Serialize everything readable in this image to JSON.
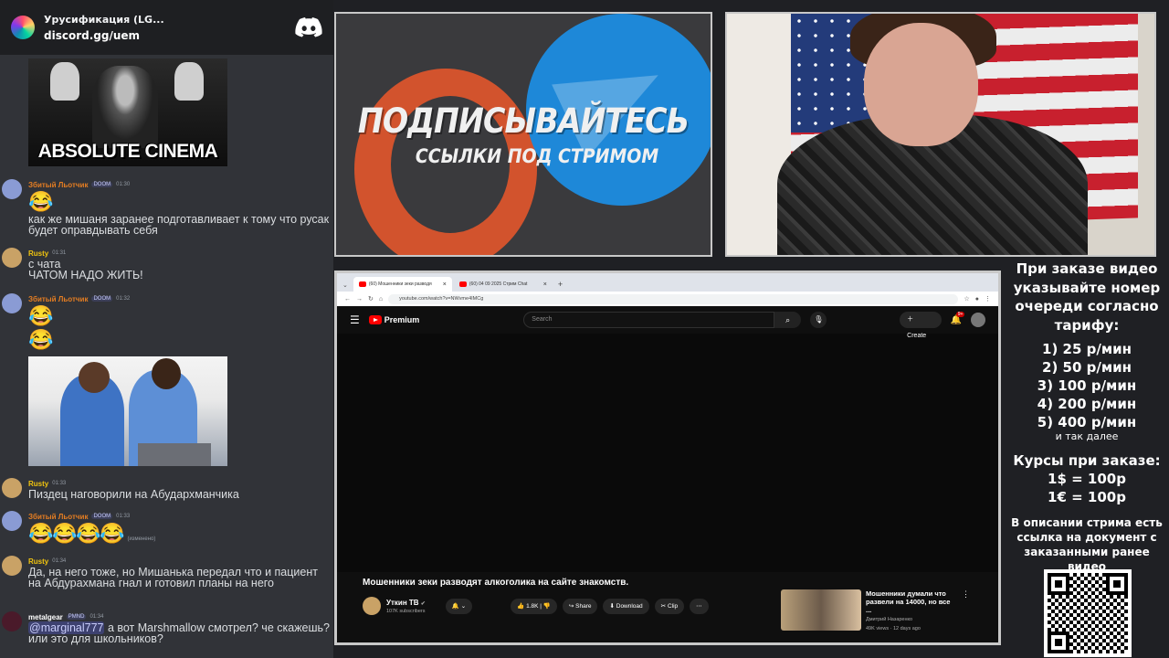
{
  "chat": {
    "server_name": "Урусификация (LG...",
    "server_link": "discord.gg/uem",
    "meme_caption": "ABSOLUTE CINEMA",
    "messages": [
      {
        "user": "Збитый Льотчик",
        "badge": "DOOM",
        "time": "01:30",
        "text": "как же мишаня заранее подготавливает к тому что русак будет оправдывать себя",
        "color": "#e67e22"
      },
      {
        "user": "Rusty",
        "badge": "",
        "time": "01:31",
        "line1": "с чата",
        "line2": "ЧАТОМ НАДО ЖИТЬ!",
        "color": "#f1c40f"
      },
      {
        "user": "Збитый Льотчик",
        "badge": "DOOM",
        "time": "01:32",
        "color": "#e67e22"
      },
      {
        "user": "Rusty",
        "badge": "",
        "time": "01:33",
        "text": "Пиздец наговорили на Абудархманчика",
        "color": "#f1c40f"
      },
      {
        "user": "Збитый Льотчик",
        "badge": "DOOM",
        "time": "01:33",
        "edited": "(изменено)",
        "color": "#e67e22"
      },
      {
        "user": "Rusty",
        "badge": "",
        "time": "01:34",
        "text": "Да, на него тоже, но Мишанька передал что и пациент на Абдурахмана гнал и готовил планы на него",
        "color": "#f1c40f"
      },
      {
        "user": "metalgear",
        "badge": "PMND",
        "time": "01:34",
        "mention": "@marginal777",
        "text": " а вот Marshmallow смотрел? че скажешь? или это для школьников?",
        "color": "#ffffff"
      }
    ]
  },
  "promo": {
    "title": "ПОДПИСЫВАЙТЕСЬ",
    "subtitle": "ССЫЛКИ ПОД СТРИМОМ"
  },
  "browser": {
    "tabs": [
      "(60) Мошенники зеки разводя",
      "(60) 04 09 2025 Стрим Chat"
    ],
    "url": "youtube.com/watch?v=NWvme4IMCg",
    "logo_text": "Premium",
    "search_placeholder": "Search",
    "create_label": "Create",
    "notif_count": "9+",
    "video_title": "Мошенники зеки разводят алкоголика на сайте знакомств.",
    "channel_name": "Уткин ТВ",
    "channel_subs": "107K subscribers",
    "likes": "1.8K",
    "share_label": "Share",
    "download_label": "Download",
    "clip_label": "Clip",
    "reco_title": "Мошенники думали что развели на 14000, но все ...",
    "reco_channel": "Дмитрий Назаренко",
    "reco_meta": "49K views · 12 days ago"
  },
  "info": {
    "header": "При заказе видео указывайте номер очереди согласно тарифу:",
    "tariffs": [
      "1) 25 р/мин",
      "2) 50 р/мин",
      "3) 100 р/мин",
      "4) 200 р/мин",
      "5) 400 р/мин"
    ],
    "tariff_more": "и так далее",
    "rates_title": "Курсы при заказе:",
    "rates": [
      "1$ = 100р",
      "1€ = 100р"
    ],
    "note": "В описании стрима есть ссылка на документ с заказанными ранее видео"
  }
}
